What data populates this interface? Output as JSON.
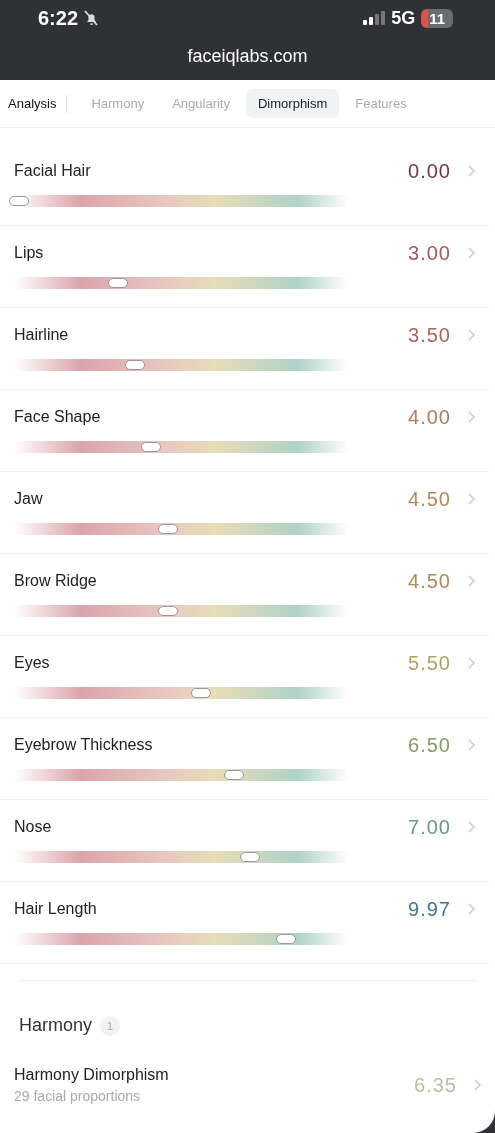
{
  "status_bar": {
    "time": "6:22",
    "network": "5G",
    "battery": "11"
  },
  "address_bar": {
    "url": "faceiqlabs.com"
  },
  "nav_title": "Analysis",
  "tabs": [
    {
      "label": "Harmony",
      "selected": false
    },
    {
      "label": "Angularity",
      "selected": false
    },
    {
      "label": "Dimorphism",
      "selected": true
    },
    {
      "label": "Features",
      "selected": false
    }
  ],
  "metrics": [
    {
      "name": "Facial Hair",
      "score": "0.00",
      "color": "#7a3a44",
      "level": 0.0
    },
    {
      "name": "Lips",
      "score": "3.00",
      "color": "#a35a5c",
      "level": 0.3
    },
    {
      "name": "Hairline",
      "score": "3.50",
      "color": "#a8685c",
      "level": 0.35
    },
    {
      "name": "Face Shape",
      "score": "4.00",
      "color": "#ad7f5e",
      "level": 0.4
    },
    {
      "name": "Jaw",
      "score": "4.50",
      "color": "#b08a5e",
      "level": 0.45
    },
    {
      "name": "Brow Ridge",
      "score": "4.50",
      "color": "#b08a5e",
      "level": 0.45
    },
    {
      "name": "Eyes",
      "score": "5.50",
      "color": "#b0a264",
      "level": 0.55
    },
    {
      "name": "Eyebrow Thickness",
      "score": "6.50",
      "color": "#8a9a66",
      "level": 0.65
    },
    {
      "name": "Nose",
      "score": "7.00",
      "color": "#6a9a7e",
      "level": 0.7
    },
    {
      "name": "Hair Length",
      "score": "9.97",
      "color": "#3f7a85",
      "level": 0.81
    }
  ],
  "section": {
    "title": "Harmony",
    "count": "1",
    "items": [
      {
        "name": "Harmony Dimorphism",
        "subtitle": "29 facial proportions",
        "score": "6.35",
        "color": "#b9c0a0"
      }
    ]
  }
}
